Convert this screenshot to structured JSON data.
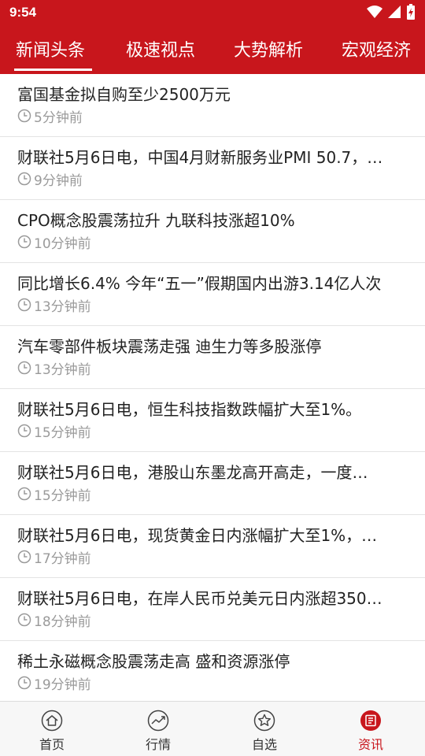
{
  "status_bar": {
    "time": "9:54"
  },
  "tabs": [
    {
      "label": "新闻头条",
      "active": true
    },
    {
      "label": "极速视点",
      "active": false
    },
    {
      "label": "大势解析",
      "active": false
    },
    {
      "label": "宏观经济",
      "active": false
    }
  ],
  "news": [
    {
      "title": "富国基金拟自购至少2500万元",
      "time": "5分钟前"
    },
    {
      "title": "财联社5月6日电，中国4月财新服务业PMI 50.7，…",
      "time": "9分钟前"
    },
    {
      "title": "CPO概念股震荡拉升 九联科技涨超10%",
      "time": "10分钟前"
    },
    {
      "title": "同比增长6.4% 今年“五一”假期国内出游3.14亿人次",
      "time": "13分钟前"
    },
    {
      "title": "汽车零部件板块震荡走强 迪生力等多股涨停",
      "time": "13分钟前"
    },
    {
      "title": "财联社5月6日电，恒生科技指数跌幅扩大至1%。",
      "time": "15分钟前"
    },
    {
      "title": "财联社5月6日电，港股山东墨龙高开高走，一度…",
      "time": "15分钟前"
    },
    {
      "title": "财联社5月6日电，现货黄金日内涨幅扩大至1%，…",
      "time": "17分钟前"
    },
    {
      "title": "财联社5月6日电，在岸人民币兑美元日内涨超350…",
      "time": "18分钟前"
    },
    {
      "title": "稀土永磁概念股震荡走高 盛和资源涨停",
      "time": "19分钟前"
    }
  ],
  "bottom_nav": [
    {
      "label": "首页",
      "icon": "home-icon",
      "active": false
    },
    {
      "label": "行情",
      "icon": "chart-icon",
      "active": false
    },
    {
      "label": "自选",
      "icon": "star-icon",
      "active": false
    },
    {
      "label": "资讯",
      "icon": "news-icon",
      "active": true
    }
  ],
  "colors": {
    "brand": "#c8161c",
    "meta": "#9a9a9a",
    "text": "#222222"
  }
}
